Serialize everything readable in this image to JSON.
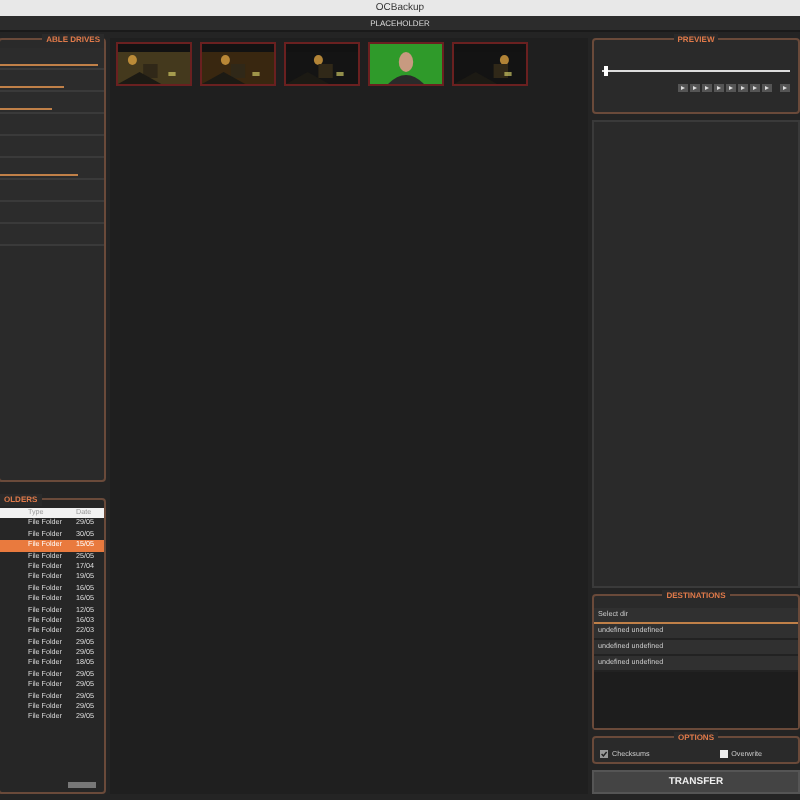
{
  "window": {
    "title": "OCBackup"
  },
  "header": {
    "label": "PLACEHOLDER"
  },
  "drives": {
    "title": "ABLE DRIVES",
    "items": [
      {
        "kind": "usage",
        "level": 0.95
      },
      {
        "kind": "usage",
        "level": 0.62
      },
      {
        "kind": "usage",
        "level": 0.5
      },
      {
        "kind": "plain"
      },
      {
        "kind": "plain"
      },
      {
        "kind": "usage",
        "level": 0.75
      },
      {
        "kind": "plain"
      },
      {
        "kind": "plain"
      },
      {
        "kind": "plain"
      }
    ]
  },
  "folders": {
    "title": "OLDERS",
    "columns": [
      "Type",
      "Date"
    ],
    "rows": [
      {
        "type": "File Folder",
        "date": "29/05",
        "selected": false
      },
      {
        "type": "File Folder",
        "date": "30/05",
        "selected": false
      },
      {
        "type": "File Folder",
        "date": "15/05",
        "selected": true
      },
      {
        "type": "File Folder",
        "date": "25/05",
        "selected": false
      },
      {
        "type": "File Folder",
        "date": "17/04",
        "selected": false
      },
      {
        "type": "File Folder",
        "date": "19/05",
        "selected": false
      },
      {
        "type": "File Folder",
        "date": "16/05",
        "selected": false
      },
      {
        "type": "File Folder",
        "date": "16/05",
        "selected": false
      },
      {
        "type": "File Folder",
        "date": "12/05",
        "selected": false
      },
      {
        "type": "File Folder",
        "date": "16/03",
        "selected": false
      },
      {
        "type": "File Folder",
        "date": "22/03",
        "selected": false
      },
      {
        "type": "File Folder",
        "date": "29/05",
        "selected": false
      },
      {
        "type": "File Folder",
        "date": "29/05",
        "selected": false
      },
      {
        "type": "File Folder",
        "date": "18/05",
        "selected": false
      },
      {
        "type": "File Folder",
        "date": "29/05",
        "selected": false
      },
      {
        "type": "File Folder",
        "date": "29/05",
        "selected": false
      },
      {
        "type": "File Folder",
        "date": "29/05",
        "selected": false
      },
      {
        "type": "File Folder",
        "date": "29/05",
        "selected": false
      },
      {
        "type": "File Folder",
        "date": "29/05",
        "selected": false
      }
    ]
  },
  "preview": {
    "title": "PREVIEW",
    "level": 0.02
  },
  "destinations": {
    "title": "DESTINATIONS",
    "items": [
      {
        "label": "Select dir",
        "selected": true
      },
      {
        "label": "undefined undefined",
        "selected": false
      },
      {
        "label": "undefined undefined",
        "selected": false
      },
      {
        "label": "undefined undefined",
        "selected": false
      }
    ]
  },
  "options": {
    "title": "OPTIONS",
    "items": [
      {
        "label": "Checksums",
        "checked": true
      },
      {
        "label": "Overwrite",
        "checked": false
      }
    ]
  },
  "transfer": {
    "label": "TRANSFER"
  }
}
